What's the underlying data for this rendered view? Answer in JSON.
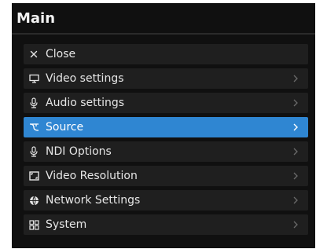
{
  "panel": {
    "title": "Main"
  },
  "menu": {
    "items": [
      {
        "label": "Close",
        "icon": "close-icon",
        "has_chevron": false,
        "active": false
      },
      {
        "label": "Video settings",
        "icon": "monitor-icon",
        "has_chevron": true,
        "active": false
      },
      {
        "label": "Audio settings",
        "icon": "microphone-icon",
        "has_chevron": true,
        "active": false
      },
      {
        "label": "Source",
        "icon": "source-icon",
        "has_chevron": true,
        "active": true
      },
      {
        "label": "NDI Options",
        "icon": "microphone-icon",
        "has_chevron": true,
        "active": false
      },
      {
        "label": "Video Resolution",
        "icon": "resolution-icon",
        "has_chevron": true,
        "active": false
      },
      {
        "label": "Network Settings",
        "icon": "globe-icon",
        "has_chevron": true,
        "active": false
      },
      {
        "label": "System",
        "icon": "system-grid-icon",
        "has_chevron": true,
        "active": false
      }
    ]
  },
  "colors": {
    "panel_bg": "#101010",
    "item_bg": "#1f1f1f",
    "active_bg": "#2f86d2",
    "text": "#e6e6e6",
    "chevron": "#6a6a6a"
  }
}
